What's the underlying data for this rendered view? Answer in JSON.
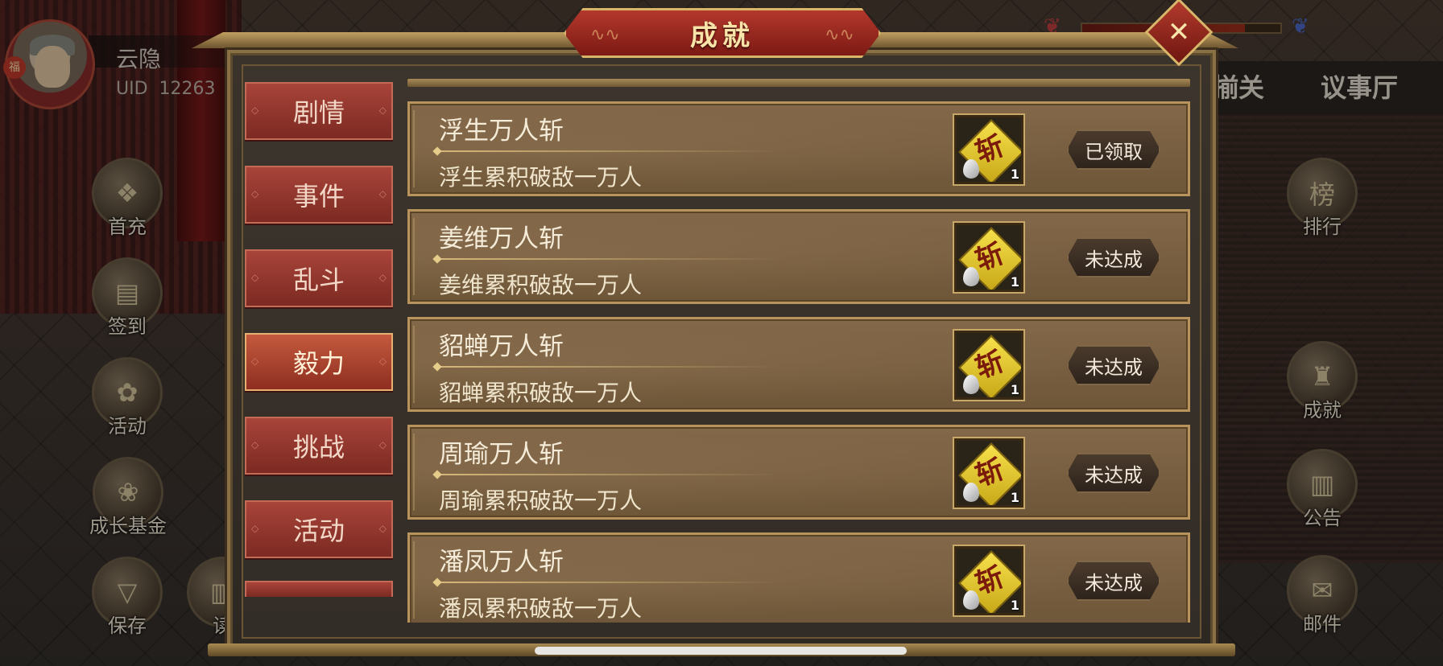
{
  "player": {
    "name": "云隐",
    "uid_label": "UID",
    "uid_value": "12263",
    "badge": "福"
  },
  "top_tabs": {
    "partial": "揃关",
    "council": "议事厅"
  },
  "left_menu": [
    {
      "label": "首充",
      "icon": "gift-icon"
    },
    {
      "label": "签到",
      "icon": "calendar-icon"
    },
    {
      "label": "活动",
      "icon": "event-icon"
    },
    {
      "label": "成长基金",
      "icon": "plant-icon"
    },
    {
      "label": "保存",
      "icon": "save-icon"
    },
    {
      "label": "读",
      "icon": "scroll-icon"
    }
  ],
  "right_menu": [
    {
      "label": "排行",
      "icon": "ranking-icon",
      "glyph": "榜"
    },
    {
      "label": "成就",
      "icon": "achievement-icon"
    },
    {
      "label": "公告",
      "icon": "notice-icon"
    },
    {
      "label": "邮件",
      "icon": "mail-icon"
    }
  ],
  "modal": {
    "title": "成就",
    "close_icon": "close-icon"
  },
  "categories": [
    {
      "label": "剧情",
      "active": false
    },
    {
      "label": "事件",
      "active": false
    },
    {
      "label": "乱斗",
      "active": false
    },
    {
      "label": "毅力",
      "active": true
    },
    {
      "label": "挑战",
      "active": false
    },
    {
      "label": "活动",
      "active": false
    }
  ],
  "achievements": [
    {
      "name": "浮生万人斩",
      "desc": "浮生累积破敌一万人",
      "reward_glyph": "斩",
      "reward_qty": "1",
      "status": "已领取"
    },
    {
      "name": "姜维万人斩",
      "desc": "姜维累积破敌一万人",
      "reward_glyph": "斩",
      "reward_qty": "1",
      "status": "未达成"
    },
    {
      "name": "貂蝉万人斩",
      "desc": "貂蝉累积破敌一万人",
      "reward_glyph": "斩",
      "reward_qty": "1",
      "status": "未达成"
    },
    {
      "name": "周瑜万人斩",
      "desc": "周瑜累积破敌一万人",
      "reward_glyph": "斩",
      "reward_qty": "1",
      "status": "未达成"
    },
    {
      "name": "潘凤万人斩",
      "desc": "潘凤累积破敌一万人",
      "reward_glyph": "斩",
      "reward_qty": "1",
      "status": "未达成"
    }
  ],
  "colors": {
    "tab_red": "#a8443a",
    "card_gold": "#b8945c",
    "title_red": "#b4382c"
  }
}
